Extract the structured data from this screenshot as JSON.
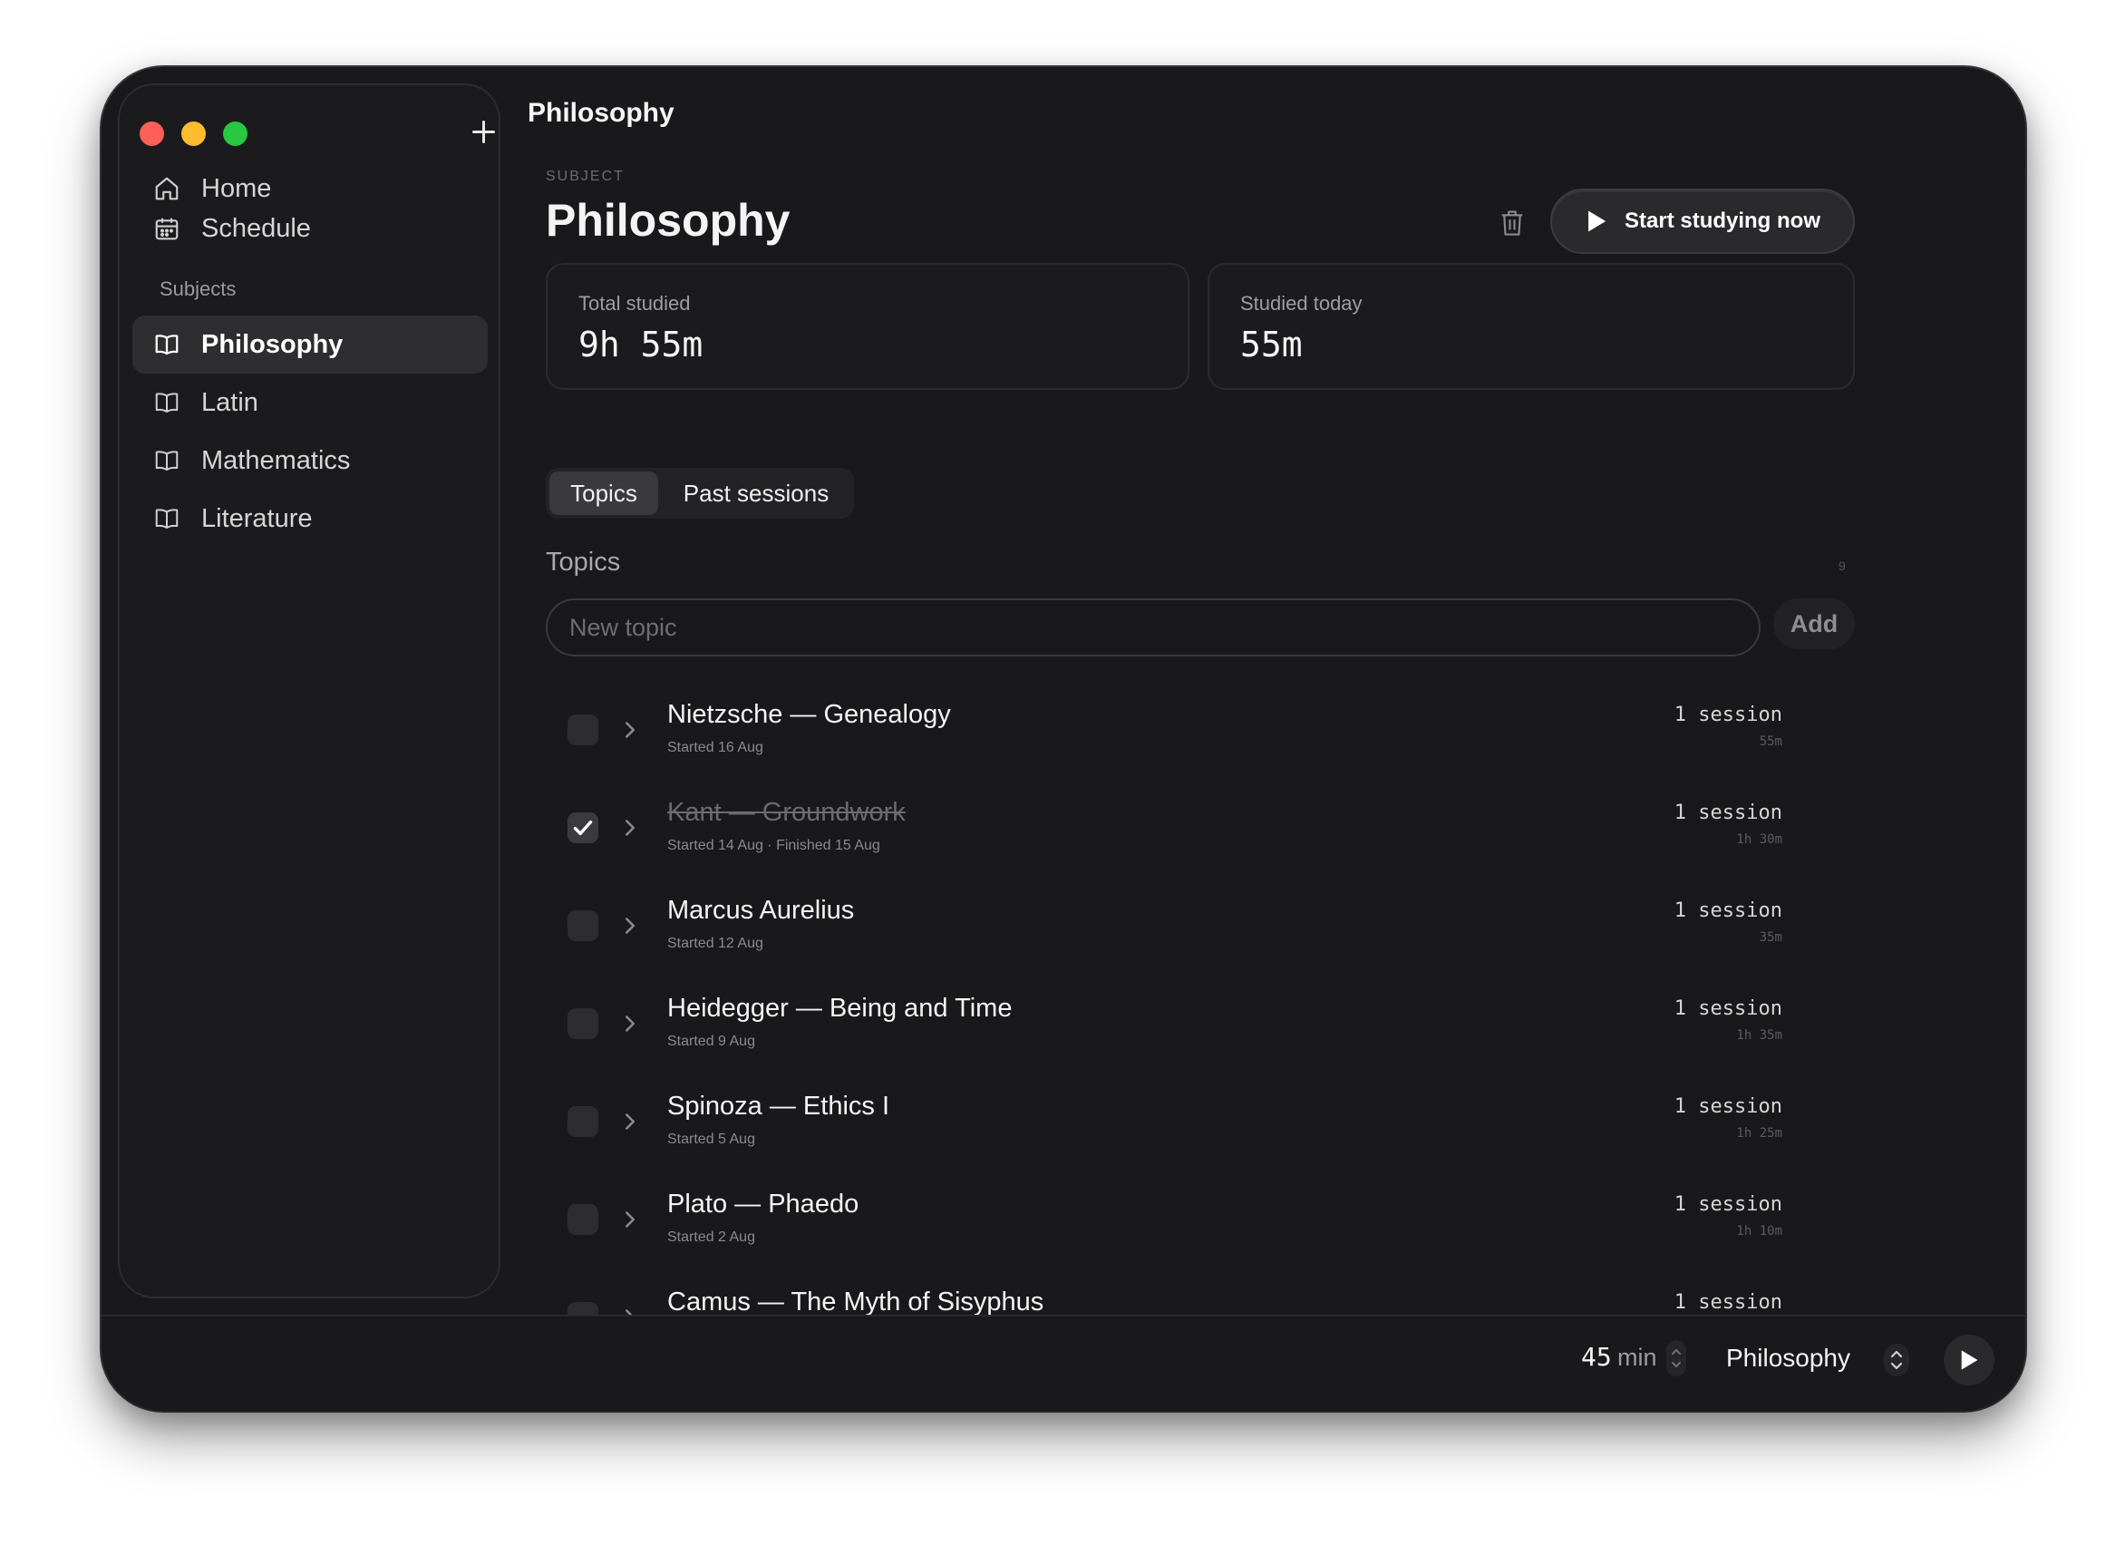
{
  "window": {
    "title": "Philosophy"
  },
  "sidebar": {
    "nav": [
      {
        "label": "Home",
        "icon": "home-icon"
      },
      {
        "label": "Schedule",
        "icon": "calendar-icon"
      }
    ],
    "section_label": "Subjects",
    "subjects": [
      {
        "label": "Philosophy",
        "icon": "book-icon",
        "active": true
      },
      {
        "label": "Latin",
        "icon": "book-icon",
        "active": false
      },
      {
        "label": "Mathematics",
        "icon": "book-icon",
        "active": false
      },
      {
        "label": "Literature",
        "icon": "book-icon",
        "active": false
      }
    ]
  },
  "header": {
    "eyebrow": "SUBJECT",
    "title": "Philosophy",
    "start_label": "Start studying now"
  },
  "stats": {
    "total_label": "Total studied",
    "total_value": "9h 55m",
    "today_label": "Studied today",
    "today_value": "55m"
  },
  "tabs": {
    "topics": "Topics",
    "past": "Past sessions",
    "active": "Topics"
  },
  "topics": {
    "label": "Topics",
    "count": "9",
    "input_placeholder": "New topic",
    "add_label": "Add",
    "items": [
      {
        "title": "Nietzsche — Genealogy",
        "meta": "Started 16 Aug",
        "sessions": "1 session",
        "duration": "55m",
        "done": false
      },
      {
        "title": "Kant — Groundwork",
        "meta": "Started 14 Aug · Finished 15 Aug",
        "sessions": "1 session",
        "duration": "1h 30m",
        "done": true
      },
      {
        "title": "Marcus Aurelius",
        "meta": "Started 12 Aug",
        "sessions": "1 session",
        "duration": "35m",
        "done": false
      },
      {
        "title": "Heidegger — Being and Time",
        "meta": "Started 9 Aug",
        "sessions": "1 session",
        "duration": "1h 35m",
        "done": false
      },
      {
        "title": "Spinoza — Ethics I",
        "meta": "Started 5 Aug",
        "sessions": "1 session",
        "duration": "1h 25m",
        "done": false
      },
      {
        "title": "Plato — Phaedo",
        "meta": "Started 2 Aug",
        "sessions": "1 session",
        "duration": "1h 10m",
        "done": false
      },
      {
        "title": "Camus — The Myth of Sisyphus",
        "meta": "",
        "sessions": "1 session",
        "duration": "",
        "done": false
      }
    ]
  },
  "bottom": {
    "duration_value": "45",
    "duration_unit": "min",
    "subject": "Philosophy"
  },
  "colors": {
    "window_bg": "#19191b",
    "sidebar_bg": "#1b1b1d",
    "active_item": "#2e2e31",
    "traffic_red": "#fe5f57",
    "traffic_yellow": "#febc2e",
    "traffic_green": "#28c840"
  }
}
